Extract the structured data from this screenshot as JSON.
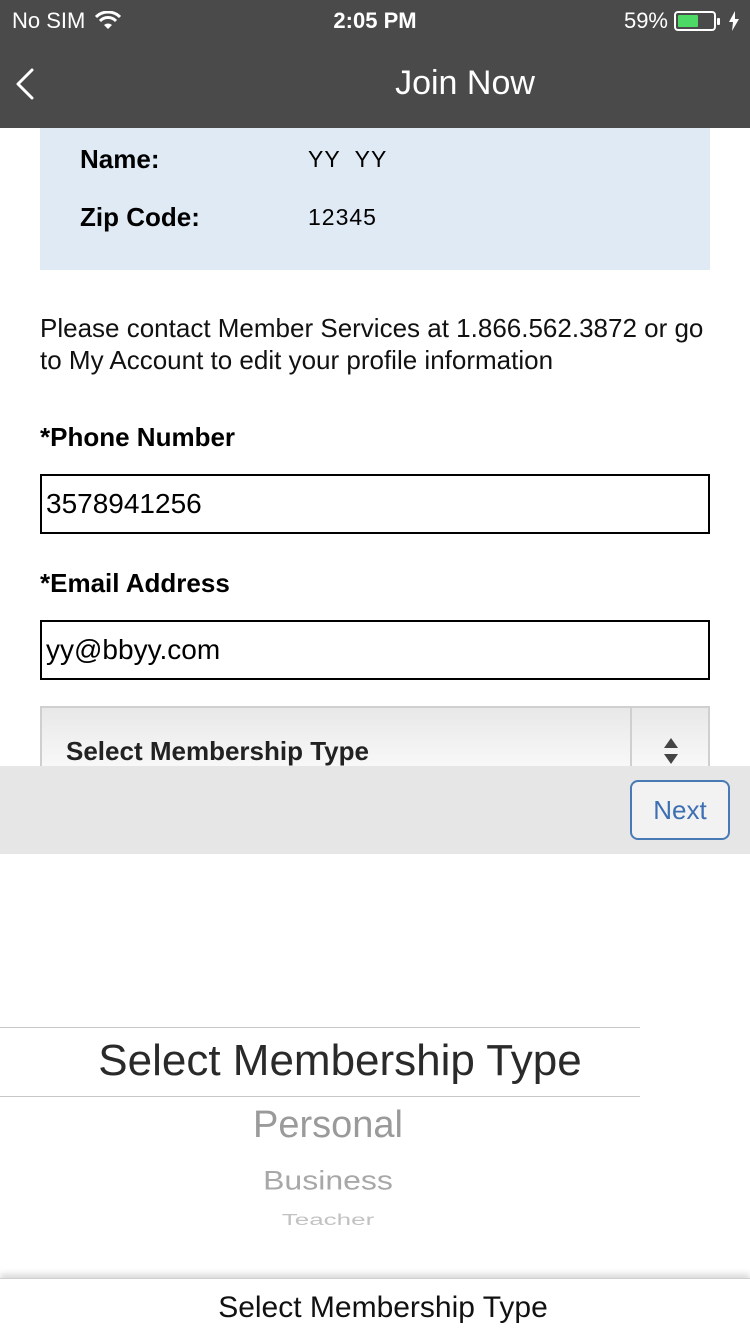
{
  "status_bar": {
    "carrier": "No SIM",
    "time": "2:05 PM",
    "battery_percent": "59%",
    "battery_level": 0.59
  },
  "nav": {
    "title": "Join Now"
  },
  "profile": {
    "name_label": "Name:",
    "name_value": "YY  YY",
    "zip_label": "Zip Code:",
    "zip_value": "12345"
  },
  "note": "Please contact Member Services at 1.866.562.3872 or go to My Account to edit your profile information",
  "form": {
    "phone_label": "*Phone Number",
    "phone_value": "3578941256",
    "email_label": "*Email Address",
    "email_value": "yy@bbyy.com",
    "membership_select": "Select Membership Type"
  },
  "toolbar": {
    "next_label": "Next"
  },
  "picker": {
    "selected": "Select Membership Type",
    "options": [
      "Personal",
      "Business",
      "Teacher"
    ]
  },
  "footer": {
    "label": "Select Membership Type"
  }
}
